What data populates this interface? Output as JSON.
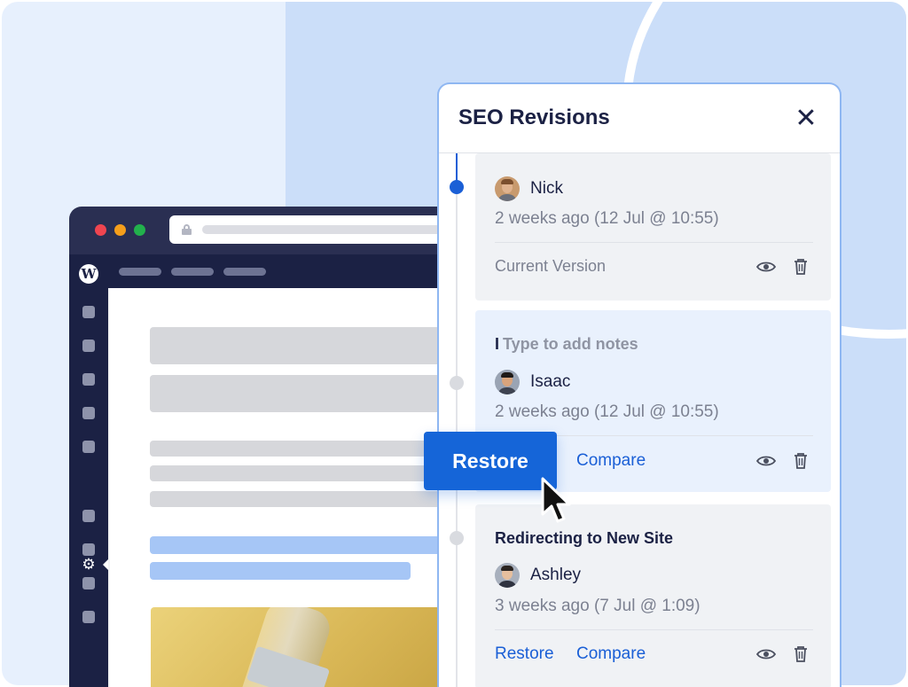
{
  "panel": {
    "title": "SEO Revisions",
    "close_icon": "close-icon"
  },
  "revisions": [
    {
      "author": "Nick",
      "time": "2 weeks ago (12 Jul @ 10:55)",
      "status": "Current Version",
      "note": ""
    },
    {
      "note": "Type to add notes",
      "author": "Isaac",
      "time": "2 weeks ago (12 Jul @ 10:55)",
      "restore_label": "Restore",
      "compare_label": "Compare"
    },
    {
      "note": "Redirecting to New Site",
      "author": "Ashley",
      "time": "3 weeks ago (7 Jul @ 1:09)",
      "restore_label": "Restore",
      "compare_label": "Compare"
    }
  ],
  "colors": {
    "accent": "#1565d8",
    "navy": "#1b2144",
    "background_left": "#e7f0fd",
    "background_right": "#cbdef9"
  },
  "browser": {
    "logo_glyph": "W"
  }
}
